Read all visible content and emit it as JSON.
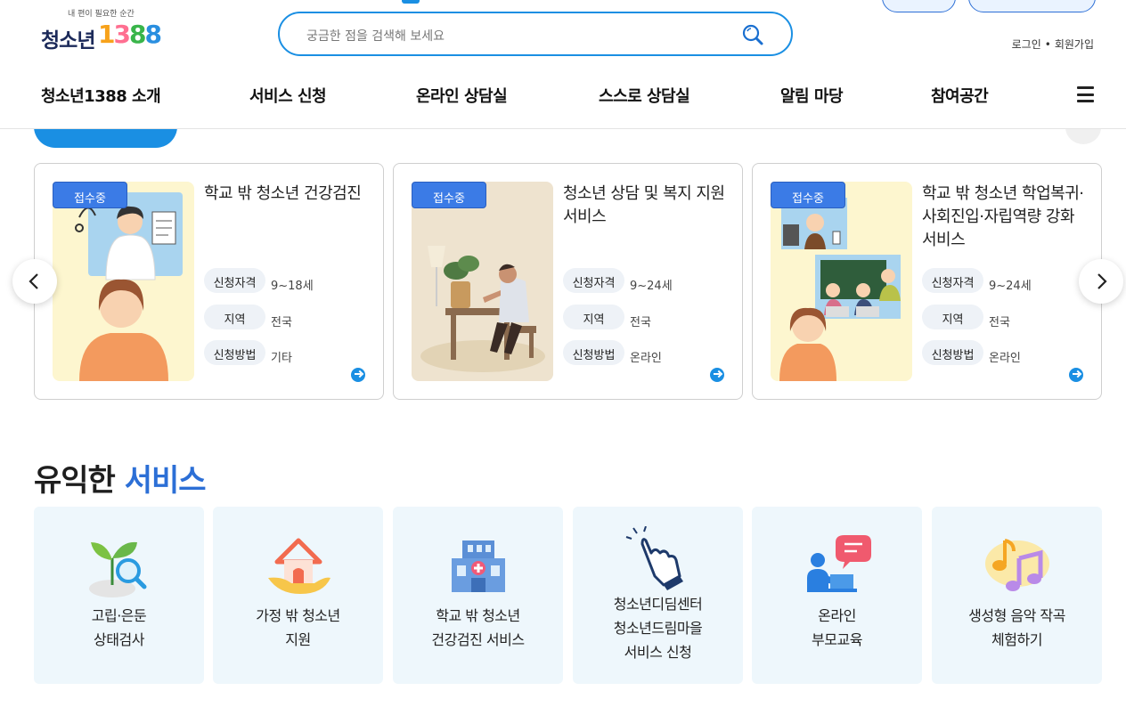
{
  "header": {
    "logo_tagline": "내 편이 필요한 순간",
    "logo_name": "청소년",
    "logo_digits": [
      "1",
      "3",
      "8",
      "8"
    ],
    "search_placeholder": "궁금한 점을 검색해 보세요",
    "login": "로그인",
    "separator": "•",
    "signup": "회원가입"
  },
  "nav": {
    "items": [
      "청소년1388 소개",
      "서비스 신청",
      "온라인 상담실",
      "스스로 상담실",
      "알림 마당",
      "참여공간"
    ]
  },
  "service_cards": [
    {
      "badge": "접수중",
      "title": "학교 밖 청소년 건강검진",
      "fields": [
        {
          "label": "신청자격",
          "value": "9~18세"
        },
        {
          "label": "지역",
          "value": "전국"
        },
        {
          "label": "신청방법",
          "value": "기타"
        }
      ]
    },
    {
      "badge": "접수중",
      "title": "청소년 상담 및 복지 지원 서비스",
      "fields": [
        {
          "label": "신청자격",
          "value": "9~24세"
        },
        {
          "label": "지역",
          "value": "전국"
        },
        {
          "label": "신청방법",
          "value": "온라인"
        }
      ]
    },
    {
      "badge": "접수중",
      "title": "학교 밖 청소년 학업복귀·사회진입·자립역량 강화 서비스",
      "fields": [
        {
          "label": "신청자격",
          "value": "9~24세"
        },
        {
          "label": "지역",
          "value": "전국"
        },
        {
          "label": "신청방법",
          "value": "온라인"
        }
      ]
    }
  ],
  "useful": {
    "title_plain": "유익한",
    "title_accent": "서비스",
    "items": [
      {
        "icon": "sprout-magnifier-icon",
        "lines": [
          "고립·은둔",
          "상태검사"
        ]
      },
      {
        "icon": "house-hand-icon",
        "lines": [
          "가정 밖 청소년",
          "지원"
        ]
      },
      {
        "icon": "hospital-icon",
        "lines": [
          "학교 밖 청소년",
          "건강검진 서비스"
        ]
      },
      {
        "icon": "pointing-hand-icon",
        "lines": [
          "청소년디딤센터",
          "청소년드림마을",
          "서비스 신청"
        ]
      },
      {
        "icon": "online-chat-person-icon",
        "lines": [
          "온라인",
          "부모교육"
        ]
      },
      {
        "icon": "music-note-icon",
        "lines": [
          "생성형 음악 작곡",
          "체험하기"
        ]
      }
    ]
  },
  "colors": {
    "primary": "#1a8fe3",
    "accent": "#2c6fd6",
    "badge": "#3b7be6",
    "service_bg": "#eef7fc"
  }
}
